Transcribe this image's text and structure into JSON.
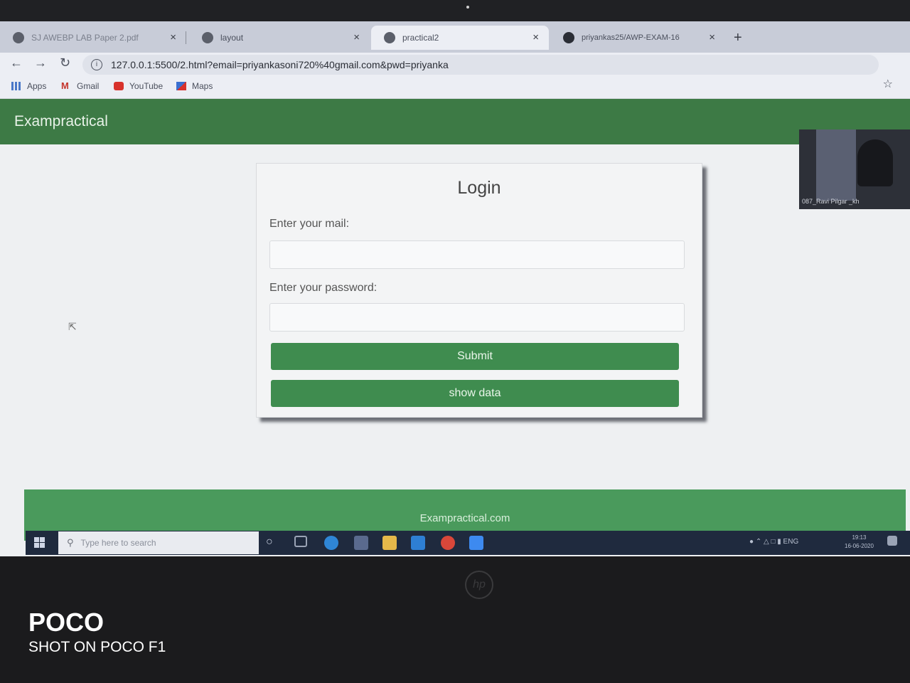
{
  "browser": {
    "tabs": [
      {
        "title": "SJ AWEBP LAB Paper 2.pdf",
        "active": false
      },
      {
        "title": "layout",
        "active": false
      },
      {
        "title": "practical2",
        "active": true
      },
      {
        "title": "priyankas25/AWP-EXAM-16",
        "active": false
      }
    ],
    "new_tab": "+",
    "close_glyph": "×",
    "url": "127.0.0.1:5500/2.html?email=priyankasoni720%40gmail.com&pwd=priyanka",
    "bookmarks": [
      {
        "label": "Apps",
        "icon": "apps-grid-icon"
      },
      {
        "label": "Gmail",
        "icon": "gmail-icon"
      },
      {
        "label": "YouTube",
        "icon": "youtube-icon"
      },
      {
        "label": "Maps",
        "icon": "maps-icon"
      }
    ]
  },
  "page": {
    "brand": "Exampractical",
    "login": {
      "title": "Login",
      "email_label": "Enter your mail:",
      "email_value": "",
      "password_label": "Enter your password:",
      "password_value": "",
      "submit_label": "Submit",
      "show_data_label": "show data"
    },
    "footer": "Exampractical.com"
  },
  "webcam": {
    "name": "087_Ravi Pilgar _kh"
  },
  "taskbar": {
    "search_placeholder": "Type here to search",
    "tray_lang": "ENG",
    "time": "19:13",
    "date": "16-06-2020"
  },
  "photo_watermark": {
    "brand": "POCO",
    "caption": "SHOT ON POCO F1"
  },
  "colors": {
    "navbar": "#3d7a45",
    "button": "#3f8c4f",
    "footer": "#4a9a5c"
  }
}
